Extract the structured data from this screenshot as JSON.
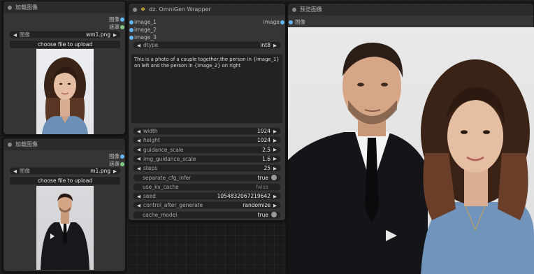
{
  "colors": {
    "image_socket": "#64b5f6",
    "mask_socket": "#81c784",
    "node_bg": "#353535",
    "header_bg": "#2b2b2b"
  },
  "load_image_1": {
    "title": "加载图像",
    "outputs": [
      {
        "label": "图像"
      },
      {
        "label": "遮罩"
      }
    ],
    "image_widget": {
      "label": "图像",
      "value": "wm1.png"
    },
    "upload_label": "choose file to upload",
    "preview_icon": "portrait-woman-photo"
  },
  "load_image_2": {
    "title": "加载图像",
    "outputs": [
      {
        "label": "图像"
      },
      {
        "label": "遮罩"
      }
    ],
    "image_widget": {
      "label": "图像",
      "value": "m1.png"
    },
    "upload_label": "choose file to upload",
    "preview_icon": "portrait-man-suit-photo"
  },
  "omnigen": {
    "title": "dz. OmniGen Wrapper",
    "title_icon": "lamp-emoji",
    "inputs": [
      "image_1",
      "image_2",
      "image_3"
    ],
    "output_label": "image",
    "dtype": {
      "label": "dtype",
      "value": "int8"
    },
    "prompt": "This is a photo of a couple together,the person in {image_1} on left and the person in {image_2} on right",
    "widgets": [
      {
        "label": "width",
        "value": "1024",
        "type": "number"
      },
      {
        "label": "height",
        "value": "1024",
        "type": "number"
      },
      {
        "label": "guidance_scale",
        "value": "2.5",
        "type": "number"
      },
      {
        "label": "img_guidance_scale",
        "value": "1.6",
        "type": "number"
      },
      {
        "label": "steps",
        "value": "25",
        "type": "number"
      },
      {
        "label": "separate_cfg_infer",
        "value": "true",
        "type": "toggle",
        "on": true
      },
      {
        "label": "use_kv_cache",
        "value": "false",
        "type": "toggle",
        "on": false
      },
      {
        "label": "seed",
        "value": "1054832067219642",
        "type": "number"
      },
      {
        "label": "control_after_generate",
        "value": "randomize",
        "type": "combo"
      },
      {
        "label": "cache_model",
        "value": "true",
        "type": "toggle",
        "on": true
      }
    ]
  },
  "preview": {
    "title": "预览图像",
    "inputs": [
      {
        "label": "图像"
      }
    ],
    "preview_icon": "couple-photo"
  }
}
